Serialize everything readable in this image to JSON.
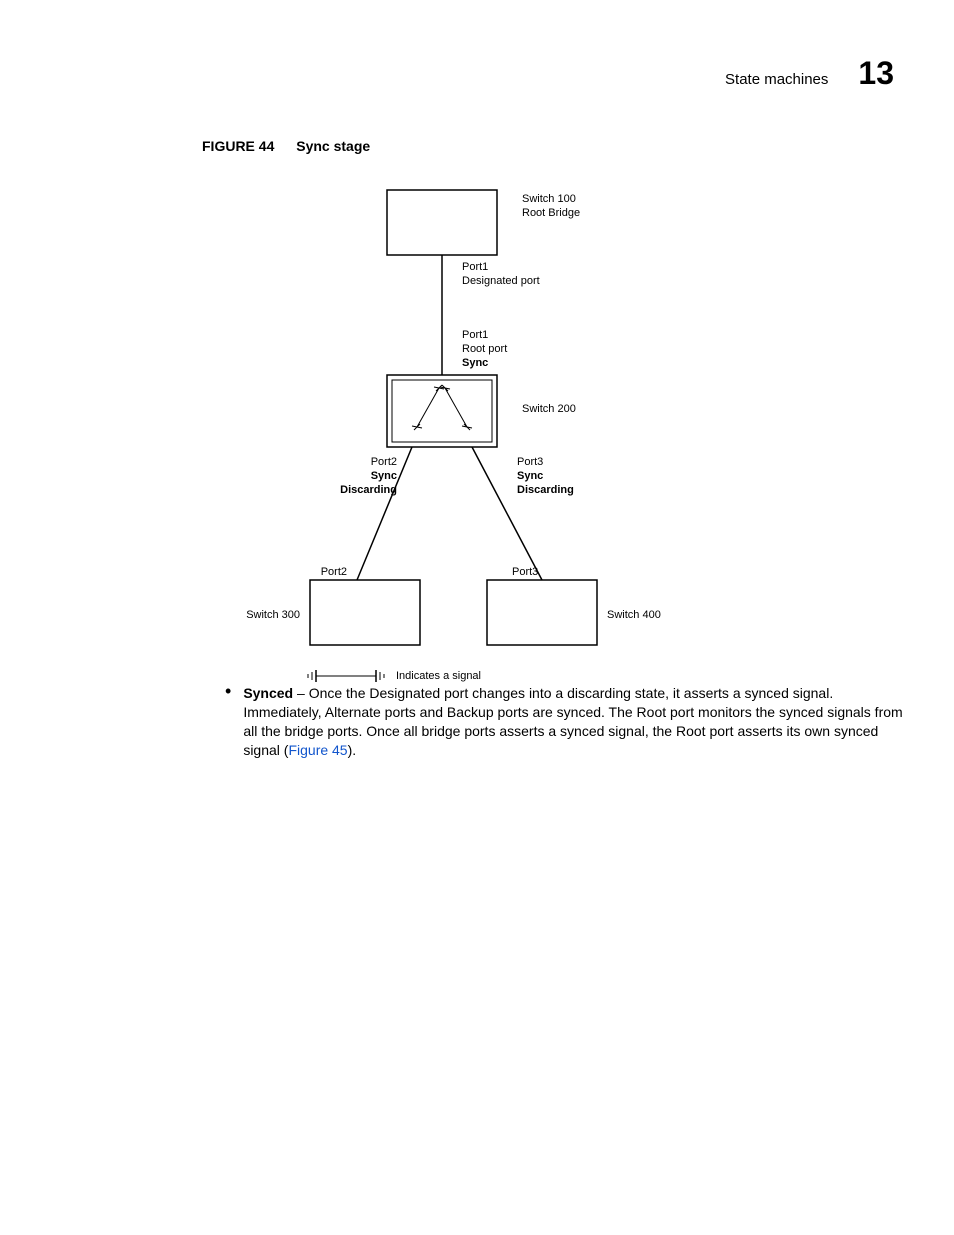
{
  "header": {
    "section": "State machines",
    "chapter": "13"
  },
  "figure": {
    "label": "FIGURE 44",
    "caption": "Sync stage"
  },
  "diagram": {
    "switch100": {
      "line1": "Switch 100",
      "line2": "Root Bridge"
    },
    "port1top": {
      "line1": "Port1",
      "line2": "Designated port"
    },
    "port1mid": {
      "line1": "Port1",
      "line2": "Root port",
      "line3": "Sync"
    },
    "switch200": "Switch 200",
    "port2mid": {
      "line1": "Port2",
      "line2": "Sync",
      "line3": "Discarding"
    },
    "port3mid": {
      "line1": "Port3",
      "line2": "Sync",
      "line3": "Discarding"
    },
    "port2bot": "Port2",
    "port3bot": "Port3",
    "switch300": "Switch 300",
    "switch400": "Switch 400"
  },
  "legend": {
    "text": "Indicates a signal"
  },
  "bullet": {
    "lead": "Synced",
    "rest1": " – Once the Designated port changes into a discarding state, it asserts a synced signal. Immediately, Alternate ports and Backup ports are synced. The Root port monitors the synced signals from all the bridge ports. Once all bridge ports asserts a synced signal, the Root port asserts its own synced signal (",
    "link": "Figure 45",
    "rest2": ")."
  }
}
